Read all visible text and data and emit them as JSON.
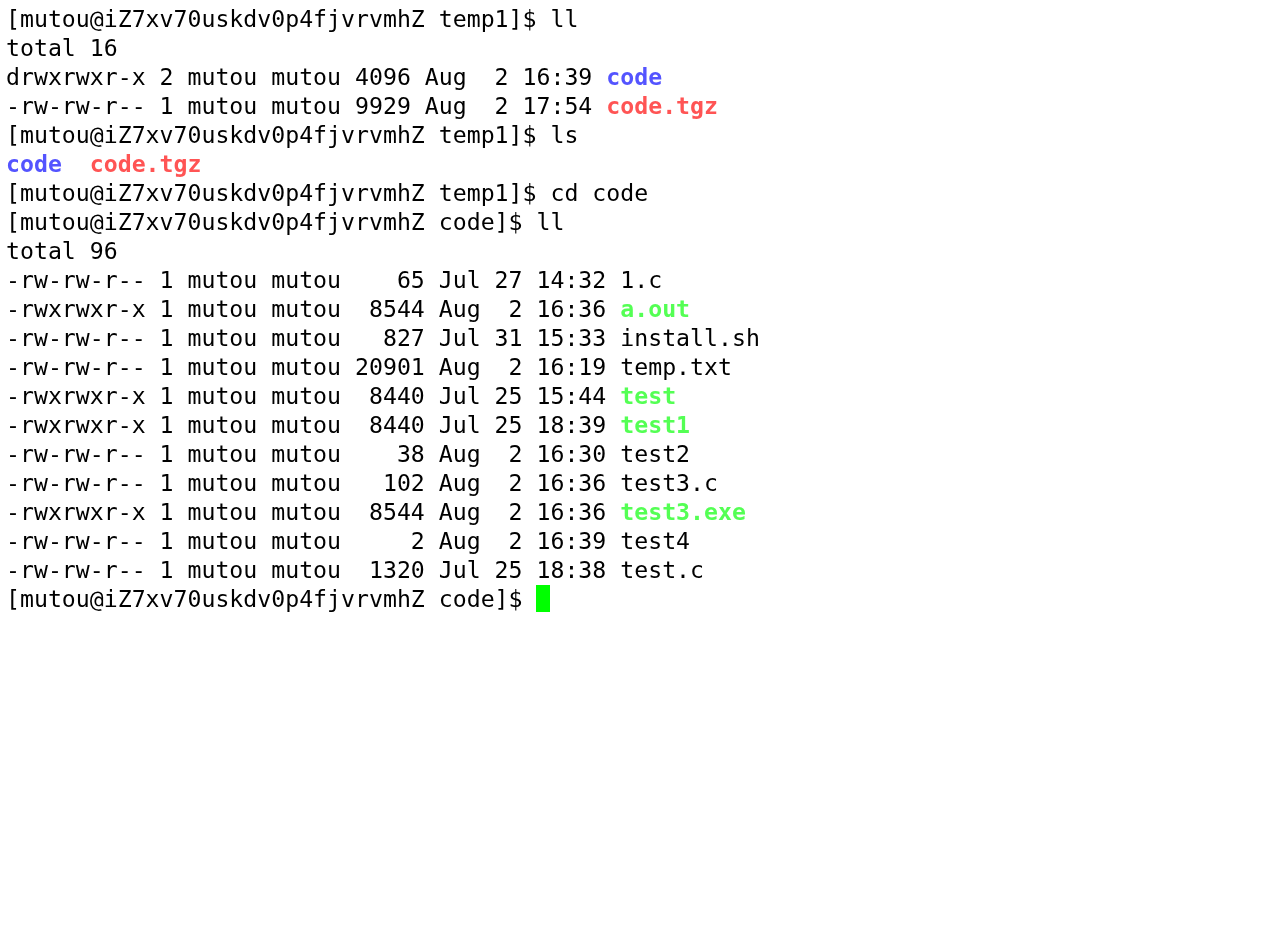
{
  "terminal": {
    "cursor": true,
    "lines": [
      {
        "segments": [
          {
            "text": "[mutou@iZ7xv70uskdv0p4fjvrvmhZ temp1]$ ll",
            "kind": "plain"
          }
        ]
      },
      {
        "segments": [
          {
            "text": "total 16",
            "kind": "plain"
          }
        ]
      },
      {
        "segments": [
          {
            "text": "drwxrwxr-x 2 mutou mutou 4096 Aug  2 16:39 ",
            "kind": "plain"
          },
          {
            "text": "code",
            "kind": "dir"
          }
        ]
      },
      {
        "segments": [
          {
            "text": "-rw-rw-r-- 1 mutou mutou 9929 Aug  2 17:54 ",
            "kind": "plain"
          },
          {
            "text": "code.tgz",
            "kind": "archive"
          }
        ]
      },
      {
        "segments": [
          {
            "text": "[mutou@iZ7xv70uskdv0p4fjvrvmhZ temp1]$ ls",
            "kind": "plain"
          }
        ]
      },
      {
        "segments": [
          {
            "text": "code",
            "kind": "dir"
          },
          {
            "text": "code.tgz",
            "kind": "archive"
          }
        ]
      },
      {
        "segments": [
          {
            "text": "[mutou@iZ7xv70uskdv0p4fjvrvmhZ temp1]$ cd code",
            "kind": "plain"
          }
        ]
      },
      {
        "segments": [
          {
            "text": "[mutou@iZ7xv70uskdv0p4fjvrvmhZ code]$ ll",
            "kind": "plain"
          }
        ]
      },
      {
        "segments": [
          {
            "text": "total 96",
            "kind": "plain"
          }
        ]
      },
      {
        "segments": [
          {
            "text": "-rw-rw-r-- 1 mutou mutou    65 Jul 27 14:32 ",
            "kind": "plain"
          },
          {
            "text": "1.c",
            "kind": "plain"
          }
        ]
      },
      {
        "segments": [
          {
            "text": "-rwxrwxr-x 1 mutou mutou  8544 Aug  2 16:36 ",
            "kind": "plain"
          },
          {
            "text": "a.out",
            "kind": "exec"
          }
        ]
      },
      {
        "segments": [
          {
            "text": "-rw-rw-r-- 1 mutou mutou   827 Jul 31 15:33 ",
            "kind": "plain"
          },
          {
            "text": "install.sh",
            "kind": "plain"
          }
        ]
      },
      {
        "segments": [
          {
            "text": "-rw-rw-r-- 1 mutou mutou 20901 Aug  2 16:19 ",
            "kind": "plain"
          },
          {
            "text": "temp.txt",
            "kind": "plain"
          }
        ]
      },
      {
        "segments": [
          {
            "text": "-rwxrwxr-x 1 mutou mutou  8440 Jul 25 15:44 ",
            "kind": "plain"
          },
          {
            "text": "test",
            "kind": "exec"
          }
        ]
      },
      {
        "segments": [
          {
            "text": "-rwxrwxr-x 1 mutou mutou  8440 Jul 25 18:39 ",
            "kind": "plain"
          },
          {
            "text": "test1",
            "kind": "exec"
          }
        ]
      },
      {
        "segments": [
          {
            "text": "-rw-rw-r-- 1 mutou mutou    38 Aug  2 16:30 ",
            "kind": "plain"
          },
          {
            "text": "test2",
            "kind": "plain"
          }
        ]
      },
      {
        "segments": [
          {
            "text": "-rw-rw-r-- 1 mutou mutou   102 Aug  2 16:36 ",
            "kind": "plain"
          },
          {
            "text": "test3.c",
            "kind": "plain"
          }
        ]
      },
      {
        "segments": [
          {
            "text": "-rwxrwxr-x 1 mutou mutou  8544 Aug  2 16:36 ",
            "kind": "plain"
          },
          {
            "text": "test3.exe",
            "kind": "exec"
          }
        ]
      },
      {
        "segments": [
          {
            "text": "-rw-rw-r-- 1 mutou mutou     2 Aug  2 16:39 ",
            "kind": "plain"
          },
          {
            "text": "test4",
            "kind": "plain"
          }
        ]
      },
      {
        "segments": [
          {
            "text": "-rw-rw-r-- 1 mutou mutou  1320 Jul 25 18:38 ",
            "kind": "plain"
          },
          {
            "text": "test.c",
            "kind": "plain"
          }
        ]
      },
      {
        "segments": [
          {
            "text": "[mutou@iZ7xv70uskdv0p4fjvrvmhZ code]$ ",
            "kind": "plain"
          }
        ]
      }
    ]
  }
}
